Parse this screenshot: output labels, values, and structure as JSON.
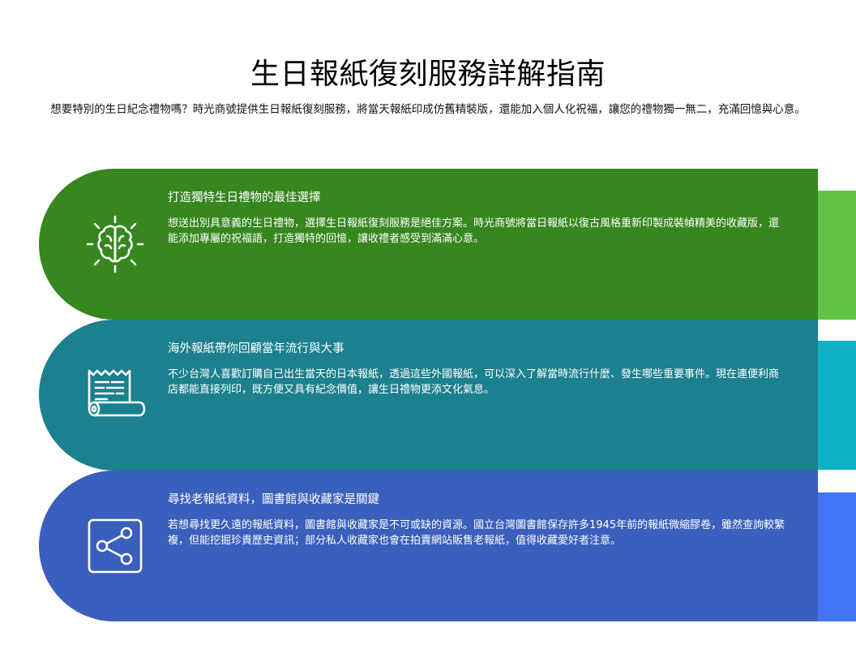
{
  "title": "生日報紙復刻服務詳解指南",
  "subtitle": "想要特別的生日紀念禮物嗎？時光商號提供生日報紙復刻服務，將當天報紙印成仿舊精裝版，還能加入個人化祝福，讓您的禮物獨一無二，充滿回憶與心意。",
  "sections": [
    {
      "heading": "打造獨特生日禮物的最佳選擇",
      "text": "想送出別具意義的生日禮物，選擇生日報紙復刻服務是絕佳方案。時光商號將當日報紙以復古風格重新印製成裝幀精美的收藏版，還能添加專屬的祝福語，打造獨特的回憶，讓收禮者感受到滿滿心意。",
      "icon": "brain-icon",
      "color": "#35871e",
      "stripe_color": "#62c444"
    },
    {
      "heading": "海外報紙帶你回顧當年流行與大事",
      "text": "不少台灣人喜歡訂購自己出生當天的日本報紙，透過這些外國報紙，可以深入了解當時流行什麼、發生哪些重要事件。現在連便利商店都能直接列印，既方便又具有紀念價值，讓生日禮物更添文化氣息。",
      "icon": "receipt-scroll-icon",
      "color": "#1c808e",
      "stripe_color": "#0eb0c6"
    },
    {
      "heading": "尋找老報紙資料，圖書館與收藏家是關鍵",
      "text": "若想尋找更久遠的報紙資料，圖書館與收藏家是不可或缺的資源。國立台灣圖書館保存許多1945年前的報紙微縮膠卷，雖然查詢較繁複，但能挖掘珍貴歷史資訊；部分私人收藏家也會在拍賣網站販售老報紙，值得收藏愛好者注意。",
      "icon": "share-network-icon",
      "color": "#3a5fbc",
      "stripe_color": "#4376f7"
    }
  ]
}
